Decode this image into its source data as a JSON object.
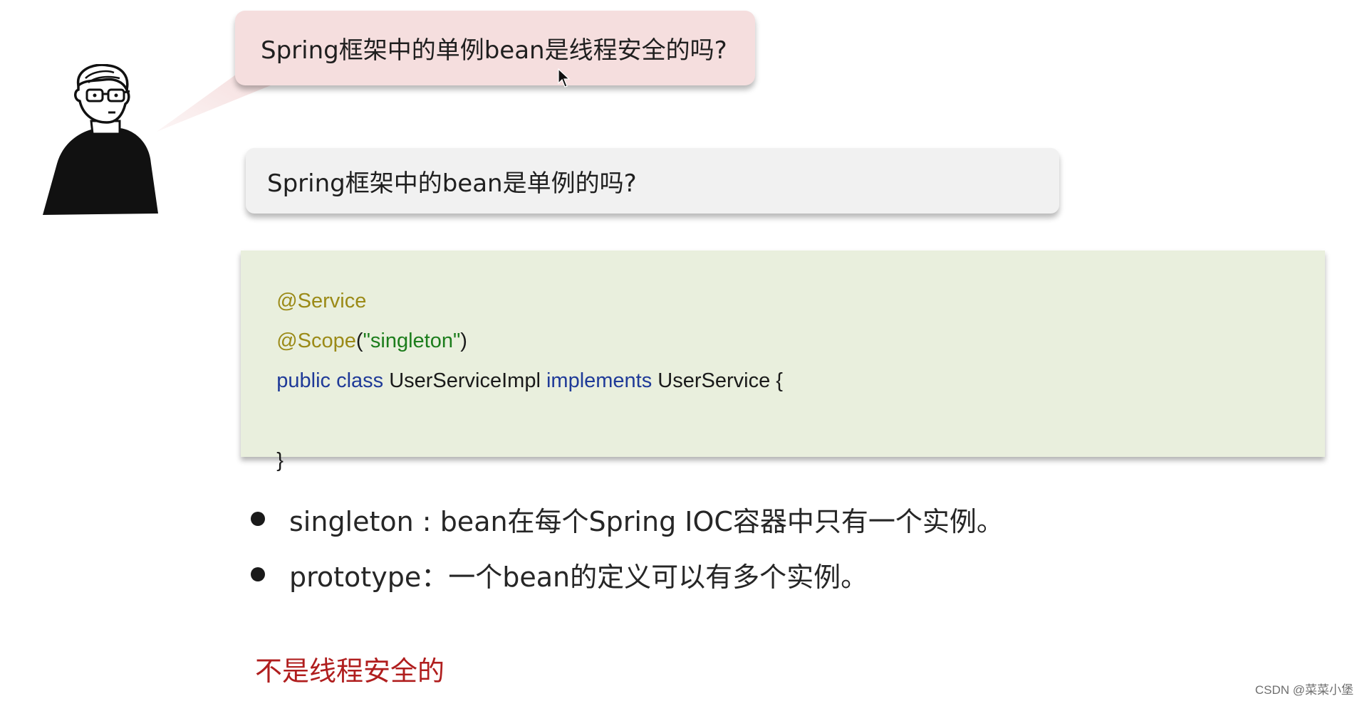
{
  "speech_bubble": {
    "text": "Spring框架中的单例bean是线程安全的吗?"
  },
  "question_box": {
    "text": "Spring框架中的bean是单例的吗?"
  },
  "code": {
    "line1": {
      "anno": "@Service"
    },
    "line2": {
      "anno": "@Scope",
      "paren_open": "(",
      "string": "\"singleton\"",
      "paren_close": ")"
    },
    "line3": {
      "kw1": "public class",
      "name": " UserServiceImpl ",
      "kw2": "implements",
      "rest": " UserService {"
    },
    "line4": {
      "close": "}"
    }
  },
  "bullets": [
    {
      "text": "singleton : bean在每个Spring IOC容器中只有一个实例。"
    },
    {
      "text": "prototype：一个bean的定义可以有多个实例。"
    }
  ],
  "answer": {
    "text": "不是线程安全的"
  },
  "watermark": {
    "text": "CSDN @菜菜小堡"
  },
  "icons": {
    "avatar": "person-with-glasses-icon",
    "cursor": "mouse-pointer-icon"
  },
  "colors": {
    "speech_bubble_bg": "#f5dede",
    "question_box_bg": "#f1f1f1",
    "code_bg": "#e9efdd",
    "annotation": "#9b8a17",
    "keyword": "#1f3a98",
    "string": "#1c7d1c",
    "answer": "#b01e1e"
  }
}
